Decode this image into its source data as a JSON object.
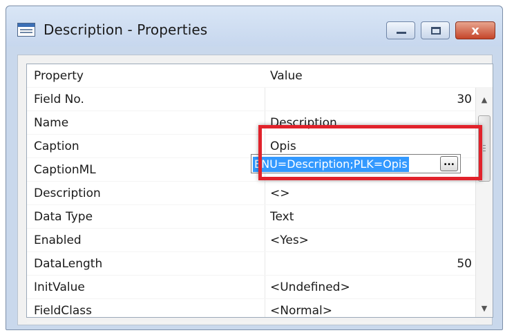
{
  "window": {
    "title": "Description - Properties",
    "close_glyph": "x"
  },
  "grid": {
    "headers": {
      "property": "Property",
      "value": "Value"
    },
    "rows": [
      {
        "property": "Field No.",
        "value": "30",
        "align": "right"
      },
      {
        "property": "Name",
        "value": "Description",
        "align": "left"
      },
      {
        "property": "Caption",
        "value": "Opis",
        "align": "left"
      },
      {
        "property": "CaptionML",
        "value": "",
        "align": "left"
      },
      {
        "property": "Description",
        "value": "<>",
        "align": "left"
      },
      {
        "property": "Data Type",
        "value": "Text",
        "align": "left"
      },
      {
        "property": "Enabled",
        "value": "<Yes>",
        "align": "left"
      },
      {
        "property": "DataLength",
        "value": "50",
        "align": "right"
      },
      {
        "property": "InitValue",
        "value": "<Undefined>",
        "align": "left"
      },
      {
        "property": "FieldClass",
        "value": "<Normal>",
        "align": "left"
      }
    ]
  },
  "editor": {
    "selected_text": "ENU=Description;PLK=Opis",
    "assist_label": "..."
  },
  "scrollbar": {
    "up_glyph": "▲",
    "down_glyph": "▼"
  },
  "colors": {
    "highlight": "#e1222b",
    "selection": "#3399ff"
  }
}
